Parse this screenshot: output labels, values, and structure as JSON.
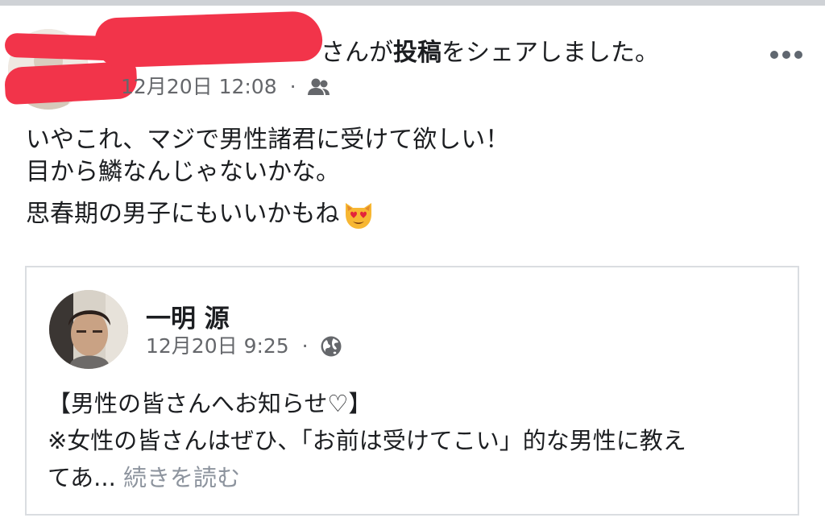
{
  "post": {
    "share_suffix_before_bold": "さんが",
    "share_bold": "投稿",
    "share_suffix_after_bold": "をシェアしました。",
    "timestamp": "12月20日 12:08",
    "separator": "·",
    "audience_icon": "friends-icon",
    "more_icon": "more-horizontal-icon",
    "lines": [
      "いやこれ、マジで男性諸君に受けて欲しい！",
      "目から鱗なんじゃないかな。",
      "思春期の男子にもいいかもね"
    ],
    "emoji": "heart-eyes-cat-emoji"
  },
  "shared": {
    "author": "一明 源",
    "timestamp": "12月20日 9:25",
    "separator": "·",
    "audience_icon": "globe-icon",
    "lines": [
      "【男性の皆さんへお知らせ♡】",
      "※女性の皆さんはぜひ、「お前は受けてこい」的な男性に教え",
      "てあ..."
    ],
    "see_more": "続きを読む"
  },
  "colors": {
    "text": "#1c1e21",
    "secondary": "#65676b",
    "see_more": "#8d949e",
    "border": "#dadde1",
    "redaction": "#f2344a"
  }
}
